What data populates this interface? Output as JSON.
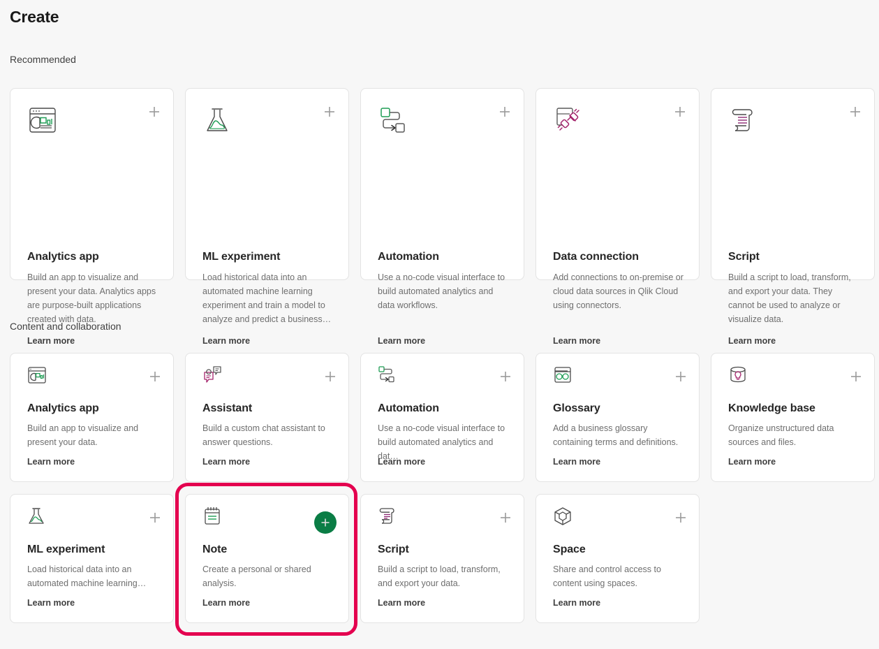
{
  "page": {
    "title": "Create",
    "background_color": "#f7f7f7",
    "card_background_color": "#ffffff",
    "highlight_color": "#e4004f",
    "primary_button_color": "#0a7d45"
  },
  "sections": [
    {
      "label": "Recommended",
      "cards": [
        {
          "title": "Analytics app",
          "description": "Build an app to visualize and present your data. Analytics apps are purpose-built applications created with data.",
          "link": "Learn more",
          "icon": "analytics-app-icon",
          "add_label": "+"
        },
        {
          "title": "ML experiment",
          "description": "Load historical data into an automated machine learning experiment and train a model to analyze and predict a business…",
          "link": "Learn more",
          "icon": "flask-icon",
          "add_label": "+"
        },
        {
          "title": "Automation",
          "description": "Use a no-code visual interface to build automated analytics and data workflows.",
          "link": "Learn more",
          "icon": "automation-flow-icon",
          "add_label": "+"
        },
        {
          "title": "Data connection",
          "description": "Add connections to on-premise or cloud data sources in Qlik Cloud using connectors.",
          "link": "Learn more",
          "icon": "data-connection-plug-icon",
          "add_label": "+"
        },
        {
          "title": "Script",
          "description": "Build a script to load, transform, and export your data. They cannot be used to analyze or visualize data.",
          "link": "Learn more",
          "icon": "script-scroll-icon",
          "add_label": "+"
        }
      ]
    },
    {
      "label": "Content and collaboration",
      "cards_row1": [
        {
          "title": "Analytics app",
          "description": "Build an app to visualize and present your data.",
          "link": "Learn more",
          "icon": "analytics-app-icon",
          "add_label": "+"
        },
        {
          "title": "Assistant",
          "description": "Build a custom chat assistant to answer questions.",
          "link": "Learn more",
          "icon": "assistant-chat-icon",
          "add_label": "+"
        },
        {
          "title": "Automation",
          "description": "Use a no-code visual interface to build automated analytics and dat…",
          "link": "Learn more",
          "icon": "automation-flow-icon",
          "add_label": "+"
        },
        {
          "title": "Glossary",
          "description": "Add a business glossary containing terms and definitions.",
          "link": "Learn more",
          "icon": "glossary-icon",
          "add_label": "+"
        },
        {
          "title": "Knowledge base",
          "description": "Organize unstructured data sources and files.",
          "link": "Learn more",
          "icon": "knowledge-base-icon",
          "add_label": "+"
        }
      ],
      "cards_row2": [
        {
          "title": "ML experiment",
          "description": "Load historical data into an automated machine learning…",
          "link": "Learn more",
          "icon": "flask-icon",
          "add_label": "+"
        },
        {
          "title": "Note",
          "description": "Create a personal or shared analysis.",
          "link": "Learn more",
          "icon": "note-icon",
          "add_label": "+",
          "highlighted": true
        },
        {
          "title": "Script",
          "description": "Build a script to load, transform, and export your data.",
          "link": "Learn more",
          "icon": "script-scroll-icon",
          "add_label": "+"
        },
        {
          "title": "Space",
          "description": "Share and control access to content using spaces.",
          "link": "Learn more",
          "icon": "space-cube-icon",
          "add_label": "+"
        }
      ]
    }
  ]
}
